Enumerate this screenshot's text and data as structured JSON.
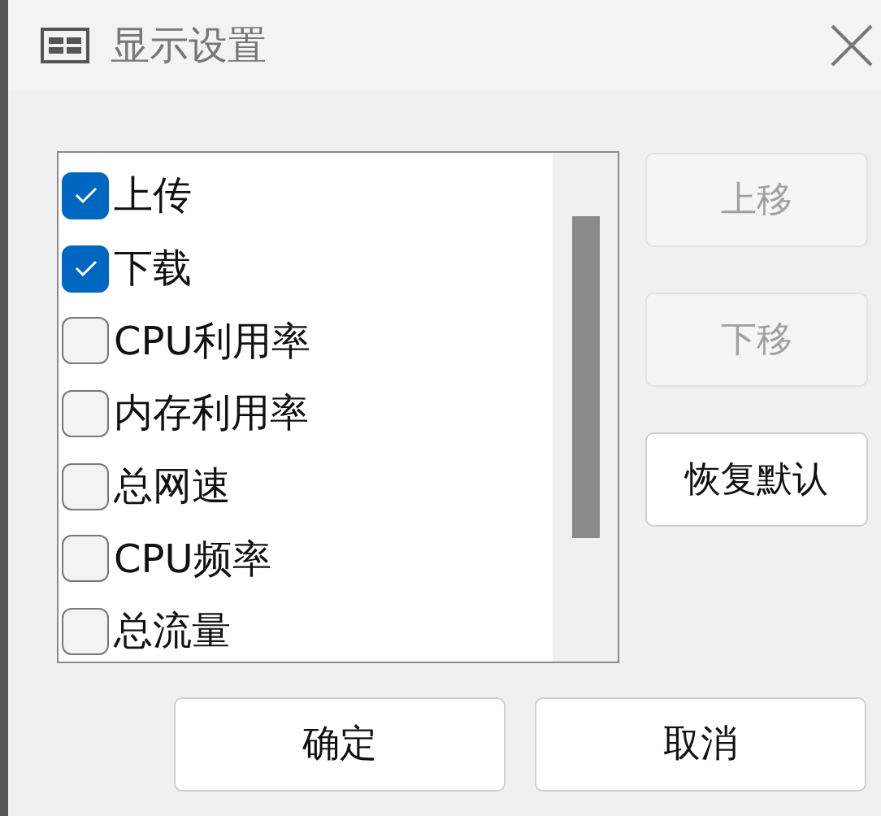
{
  "window": {
    "title": "显示设置"
  },
  "items": [
    {
      "label": "上传",
      "checked": true
    },
    {
      "label": "下载",
      "checked": true
    },
    {
      "label": "CPU利用率",
      "checked": false
    },
    {
      "label": "内存利用率",
      "checked": false
    },
    {
      "label": "总网速",
      "checked": false
    },
    {
      "label": "CPU频率",
      "checked": false
    },
    {
      "label": "总流量",
      "checked": false
    }
  ],
  "side_buttons": [
    {
      "label": "上移",
      "disabled": true
    },
    {
      "label": "下移",
      "disabled": true
    },
    {
      "label": "恢复默认",
      "disabled": false
    }
  ],
  "buttons": [
    {
      "label": "确定"
    },
    {
      "label": "取消"
    }
  ]
}
